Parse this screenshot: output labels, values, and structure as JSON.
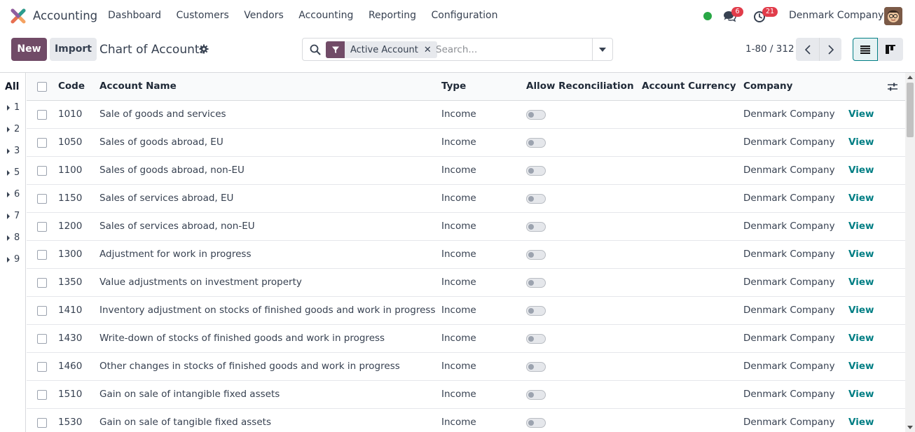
{
  "navbar": {
    "app_name": "Accounting",
    "menu": [
      "Dashboard",
      "Customers",
      "Vendors",
      "Accounting",
      "Reporting",
      "Configuration"
    ],
    "chat_count": "6",
    "activity_count": "21",
    "company": "Denmark Company"
  },
  "control_panel": {
    "new_label": "New",
    "import_label": "Import",
    "title": "Chart of Accounts",
    "facet_label": "Active Account",
    "search_placeholder": "Search...",
    "pager": "1-80 / 312"
  },
  "sidebar": {
    "all_label": "All",
    "groups": [
      "1",
      "2",
      "3",
      "5",
      "6",
      "7",
      "8",
      "9"
    ]
  },
  "table": {
    "columns": [
      "Code",
      "Account Name",
      "Type",
      "Allow Reconciliation",
      "Account Currency",
      "Company"
    ],
    "view_label": "View",
    "rows": [
      {
        "code": "1010",
        "name": "Sale of goods and services",
        "type": "Income",
        "reconcile": false,
        "currency": "",
        "company": "Denmark Company"
      },
      {
        "code": "1050",
        "name": "Sales of goods abroad, EU",
        "type": "Income",
        "reconcile": false,
        "currency": "",
        "company": "Denmark Company"
      },
      {
        "code": "1100",
        "name": "Sales of goods abroad, non-EU",
        "type": "Income",
        "reconcile": false,
        "currency": "",
        "company": "Denmark Company"
      },
      {
        "code": "1150",
        "name": "Sales of services abroad, EU",
        "type": "Income",
        "reconcile": false,
        "currency": "",
        "company": "Denmark Company"
      },
      {
        "code": "1200",
        "name": "Sales of services abroad, non-EU",
        "type": "Income",
        "reconcile": false,
        "currency": "",
        "company": "Denmark Company"
      },
      {
        "code": "1300",
        "name": "Adjustment for work in progress",
        "type": "Income",
        "reconcile": false,
        "currency": "",
        "company": "Denmark Company"
      },
      {
        "code": "1350",
        "name": "Value adjustments on investment property",
        "type": "Income",
        "reconcile": false,
        "currency": "",
        "company": "Denmark Company"
      },
      {
        "code": "1410",
        "name": "Inventory adjustment on stocks of finished goods and work in progress",
        "type": "Income",
        "reconcile": false,
        "currency": "",
        "company": "Denmark Company"
      },
      {
        "code": "1430",
        "name": "Write-down of stocks of finished goods and work in progress",
        "type": "Income",
        "reconcile": false,
        "currency": "",
        "company": "Denmark Company"
      },
      {
        "code": "1460",
        "name": "Other changes in stocks of finished goods and work in progress",
        "type": "Income",
        "reconcile": false,
        "currency": "",
        "company": "Denmark Company"
      },
      {
        "code": "1510",
        "name": "Gain on sale of intangible fixed assets",
        "type": "Income",
        "reconcile": false,
        "currency": "",
        "company": "Denmark Company"
      },
      {
        "code": "1530",
        "name": "Gain on sale of tangible fixed assets",
        "type": "Income",
        "reconcile": false,
        "currency": "",
        "company": "Denmark Company"
      }
    ]
  },
  "colors": {
    "brand": "#714b67",
    "link": "#017e84",
    "badge": "#e13c4a",
    "online": "#28a745"
  }
}
